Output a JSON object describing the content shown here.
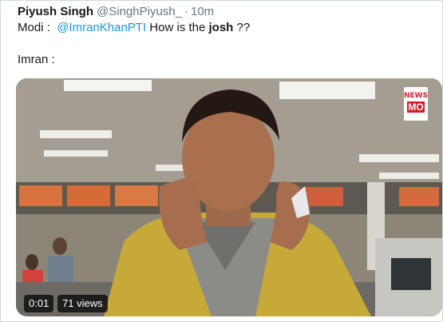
{
  "tweet": {
    "display_name": "Piyush Singh",
    "handle": "@SinghPiyush_",
    "separator": "·",
    "timestamp": "10m",
    "line1_prefix": "Modi :  ",
    "mention": "@ImranKhanPTI",
    "line1_middle": " How is the ",
    "line1_bold": "josh",
    "line1_suffix": " ??",
    "line2": "Imran :"
  },
  "media": {
    "type": "video",
    "channel_badge_top": "NEWS",
    "channel_badge_bottom": "MO",
    "duration": "0:01",
    "views": "71 views"
  },
  "colors": {
    "link": "#1b95e0",
    "secondary_text": "#657786",
    "badge_red": "#d11f2c"
  }
}
